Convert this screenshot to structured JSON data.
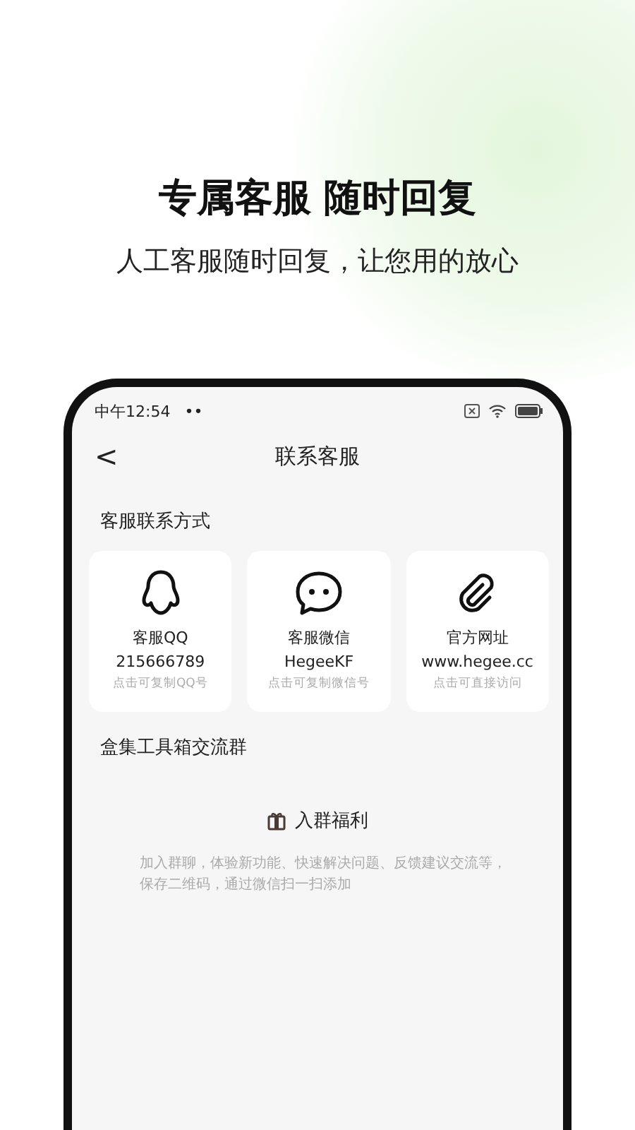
{
  "headline": "专属客服 随时回复",
  "subtitle": "人工客服随时回复，让您用的放心",
  "status_bar": {
    "time": "中午12:54",
    "dots": "••"
  },
  "nav": {
    "back": "<",
    "title": "联系客服"
  },
  "contact_section": {
    "title": "客服联系方式"
  },
  "contacts": [
    {
      "kind": "qq",
      "label": "客服QQ",
      "value": "215666789",
      "hint": "点击可复制QQ号"
    },
    {
      "kind": "wechat",
      "label": "客服微信",
      "value": "HegeeKF",
      "hint": "点击可复制微信号"
    },
    {
      "kind": "link",
      "label": "官方网址",
      "value": "www.hegee.cc",
      "hint": "点击可直接访问"
    }
  ],
  "group_section": {
    "title": "盒集工具箱交流群",
    "benefit_title": "入群福利",
    "description": "加入群聊，体验新功能、快速解决问题、反馈建议交流等，保存二维码，通过微信扫一扫添加"
  }
}
